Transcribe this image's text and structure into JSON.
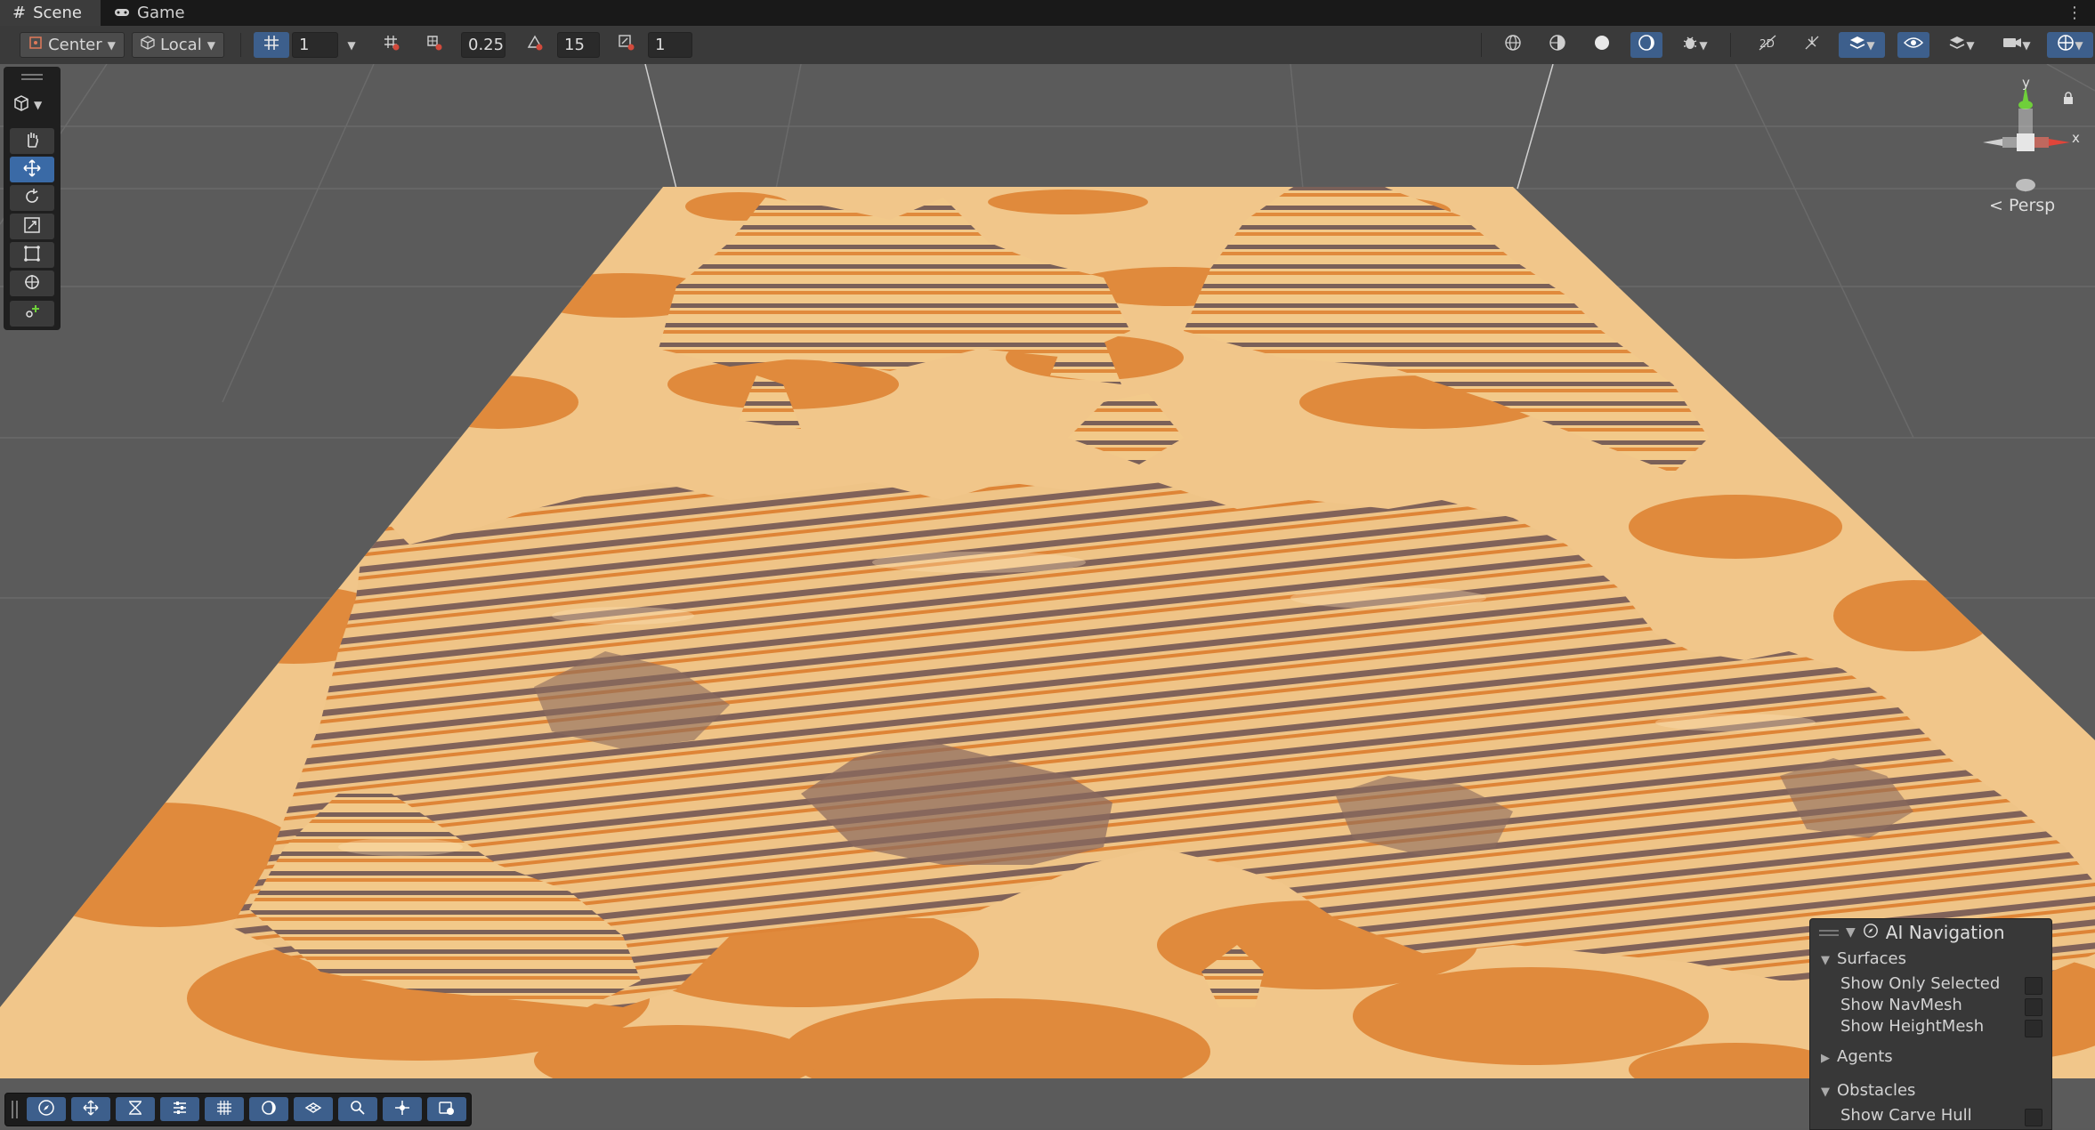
{
  "tabs": [
    {
      "label": "Scene",
      "icon": "hash-icon",
      "active": true
    },
    {
      "label": "Game",
      "icon": "gamepad-icon",
      "active": false
    }
  ],
  "toolbar": {
    "pivot_mode": "Center",
    "pivot_rotation": "Local",
    "grid_size": "1",
    "snap_increment": "0.25",
    "rotate_snap": "15",
    "scale_snap": "1"
  },
  "tools": [
    "hand-tool",
    "move-tool",
    "rotate-tool",
    "scale-tool",
    "rect-tool",
    "transform-tool",
    "custom-tool"
  ],
  "gizmo": {
    "y_label": "y",
    "x_label": "x",
    "projection": "Persp"
  },
  "ai_navigation": {
    "title": "AI Navigation",
    "surfaces": {
      "label": "Surfaces",
      "items": [
        "Show Only Selected",
        "Show NavMesh",
        "Show HeightMesh"
      ]
    },
    "agents": {
      "label": "Agents"
    },
    "obstacles": {
      "label": "Obstacles",
      "items": [
        "Show Carve Hull"
      ]
    }
  },
  "colors": {
    "sand_light": "#f2c98a",
    "sand_orange": "#e08a3c",
    "rock_brown": "#7a6058",
    "accent_blue": "#3d5f8c",
    "axis_y": "#6fcf3a",
    "axis_x": "#e0453a"
  }
}
